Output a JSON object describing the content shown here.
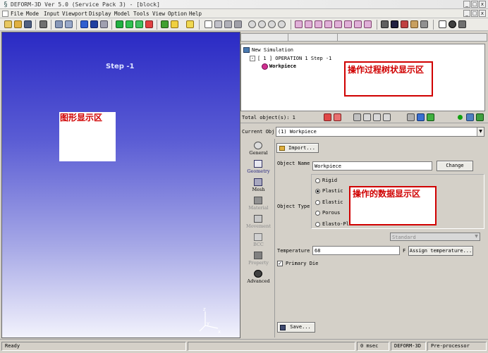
{
  "window": {
    "title": "DEFORM-3D  Ver 5.0 (Service Pack 3)  - [block]",
    "controls": [
      "_",
      "□",
      "x"
    ],
    "inner_controls": [
      "_",
      "□",
      "x"
    ]
  },
  "menu": [
    "File",
    "Mode",
    "Input",
    "Viewport",
    "Display",
    "Model",
    "Tools",
    "View",
    "Option",
    "Help"
  ],
  "viewport": {
    "step_label": "Step  -1",
    "annotation": "图形显示区",
    "axis": {
      "z": "z",
      "y": "y",
      "x": "x"
    }
  },
  "tree": {
    "root": "New Simulation",
    "operation": "[ 1 ]  OPERATION 1   Step -1",
    "object": "Workpiece",
    "annotation": "操作过程树状显示区"
  },
  "mini_toolbar": {
    "total_objects": "Total object(s): 1"
  },
  "current_object": {
    "label": "Current Obj",
    "value": "(1) Workpiece"
  },
  "side_tabs": [
    "General",
    "Geometry",
    "Mesh",
    "Material",
    "Movement",
    "BCC",
    "Property",
    "Advanced"
  ],
  "general": {
    "import_button": "Import...",
    "object_name_label": "Object Name",
    "object_name_value": "Workpiece",
    "change_button": "Change",
    "object_type_label": "Object Type",
    "types": [
      "Rigid",
      "Plastic",
      "Elastic",
      "Porous",
      "Elasto-Pla"
    ],
    "selected_type": "Plastic",
    "standard_value": "Standard",
    "annotation": "操作的数据显示区",
    "temperature_label": "Temperature",
    "temperature_value": "68",
    "temperature_unit": "F",
    "assign_temp_button": "Assign temperature...",
    "primary_die_label": "Primary Die",
    "save_button": "Save..."
  },
  "status": {
    "ready": "Ready",
    "time": "0 msec",
    "product": "DEFORM-3D",
    "mode": "Pre-processor"
  },
  "colors": {
    "accent_red": "#d00000",
    "viewport_top": "#2a2ac4",
    "panel_gray": "#d4d0c8"
  }
}
